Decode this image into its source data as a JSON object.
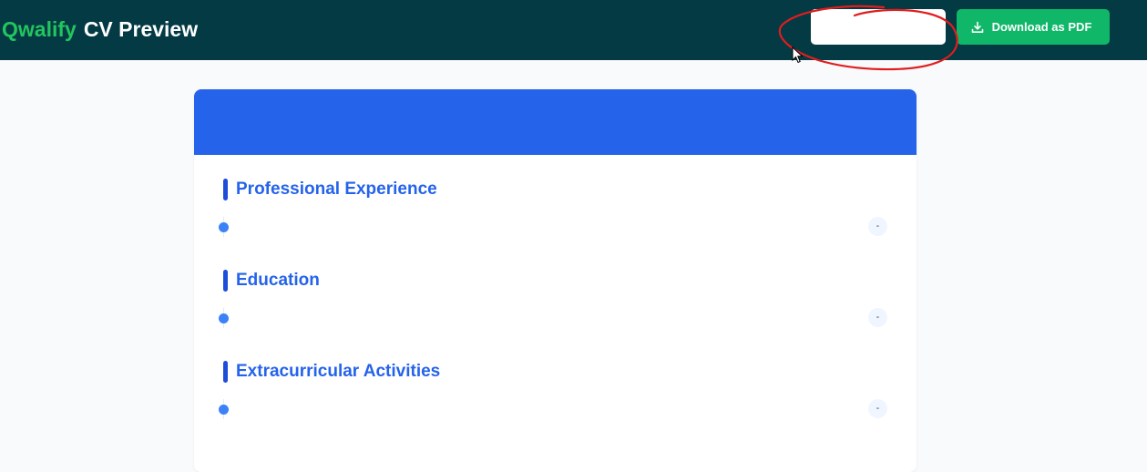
{
  "header": {
    "brand": "Qwalify",
    "title": "CV Preview",
    "blank_button_label": "",
    "download_label": "Download as PDF"
  },
  "colors": {
    "topbar": "#033a44",
    "brand_green": "#22c55e",
    "download_button": "#10b768",
    "card_header": "#2563eb",
    "section_title": "#2563eb",
    "annotation_circle": "#e11d1d",
    "page_background": "#f8fafc"
  },
  "icons": {
    "download": "download-icon",
    "cursor": "mouse-pointer-icon"
  },
  "cv": {
    "sections": [
      {
        "title": "Professional Experience",
        "entries": [
          {
            "date": "-"
          }
        ]
      },
      {
        "title": "Education",
        "entries": [
          {
            "date": "-"
          }
        ]
      },
      {
        "title": "Extracurricular Activities",
        "entries": [
          {
            "date": "-"
          }
        ]
      }
    ]
  }
}
